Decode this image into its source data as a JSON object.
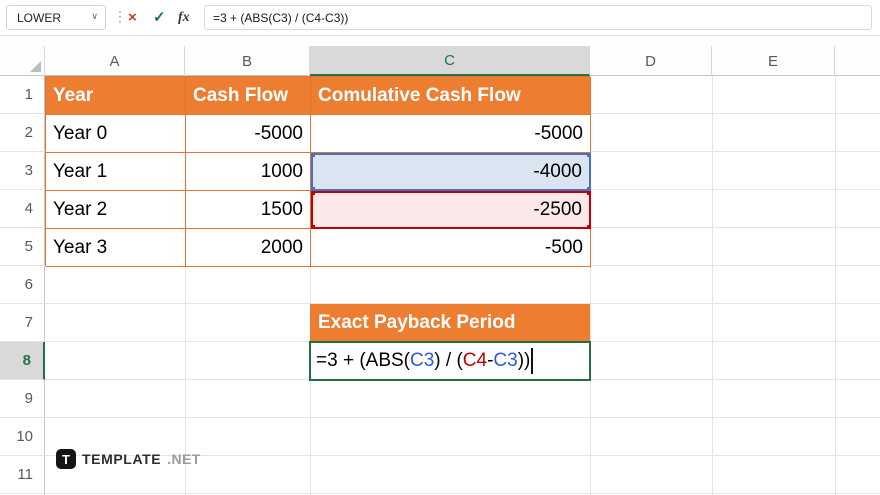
{
  "colors": {
    "table_orange": "#ED7D31",
    "selection_green": "#217346",
    "reference_blue_cell": "#4472C4",
    "reference_red_cell": "#C00000",
    "formula_ref_blue": "#2D5BD7",
    "formula_ref_red": "#C00000"
  },
  "formula_bar": {
    "name_box_value": "LOWER",
    "formula": "=3 + (ABS(C3) / (C4-C3))"
  },
  "icons": {
    "chevron_down": "∨",
    "grip_dots": "⋮",
    "cancel": "×",
    "enter": "✓",
    "function": "fx"
  },
  "sheet": {
    "column_headers": [
      "A",
      "B",
      "C",
      "D",
      "E"
    ],
    "row_headers": [
      "1",
      "2",
      "3",
      "4",
      "5",
      "6",
      "7",
      "8",
      "9",
      "10",
      "11"
    ],
    "selected_column": "C",
    "selected_row": "8"
  },
  "table": {
    "headers": {
      "a": "Year",
      "b": "Cash Flow",
      "c": "Comulative Cash Flow"
    },
    "rows": [
      {
        "year": "Year 0",
        "cash_flow": "-5000",
        "cumulative": "-5000"
      },
      {
        "year": "Year 1",
        "cash_flow": "1000",
        "cumulative": "-4000"
      },
      {
        "year": "Year 2",
        "cash_flow": "1500",
        "cumulative": "-2500"
      },
      {
        "year": "Year 3",
        "cash_flow": "2000",
        "cumulative": "-500"
      }
    ]
  },
  "payback": {
    "header": "Exact Payback Period",
    "formula_parts": [
      {
        "text": "=3 + (ABS("
      },
      {
        "text": "C3"
      },
      {
        "text": ") / ("
      },
      {
        "text": "C4"
      },
      {
        "text": "-"
      },
      {
        "text": "C3"
      },
      {
        "text": "))"
      }
    ]
  },
  "watermark": {
    "icon_letter": "T",
    "brand": "TEMPLATE",
    "suffix": ".NET"
  }
}
